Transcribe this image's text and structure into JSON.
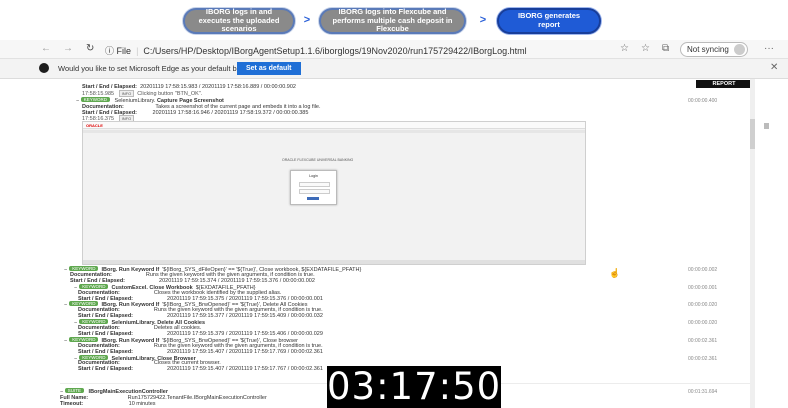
{
  "flow": {
    "steps": [
      "IBORG logs in and executes the uploaded scenarios",
      "IBORG logs into Flexcube and performs multiple cash deposit in Flexcube",
      "IBORG generates report"
    ],
    "arrow_glyph": ">"
  },
  "browser": {
    "back": "←",
    "forward": "→",
    "refresh": "↻",
    "info_icon": "ⓘ",
    "file_label": "File",
    "url": "C:/Users/HP/Desktop/IBorgAgentSetup1.1.6/iborglogs/19Nov2020/run175729422/IBorgLog.html",
    "star_icon": "☆",
    "favorites_icon": "☆",
    "collections_icon": "⧉",
    "sync_label": "Not syncing",
    "more_icon": "···"
  },
  "infobar": {
    "message": "Would you like to set Microsoft Edge as your default browser?",
    "button": "Set as default",
    "close": "✕"
  },
  "report": {
    "tag": "REPORT",
    "top_rows": [
      {
        "label": "Start / End / Elapsed:",
        "value": "20201119 17:58:15.983 / 20201119 17:58:16.889 / 00:00:00.902"
      },
      {
        "label": "17:58:15.985",
        "value": "Clicking button \"BTN_OK\"."
      }
    ],
    "capture": {
      "badge": "KEYWORD",
      "lib": "SeleniumLibrary.",
      "name": "Capture Page Screenshot",
      "doc_label": "Documentation:",
      "doc": "Takes a screenshot of the current page and embeds it into a log file.",
      "sel_label": "Start / End / Elapsed:",
      "sel": "20201119 17:58:16.946 / 20201119 17:58:19.372 / 00:00:00.385",
      "ts": "17:58:16.375",
      "detail": "INFO",
      "time": "00:00:00.400"
    },
    "screenshot": {
      "brand": "ORACLE",
      "app_title": "ORACLE FLEXCUBE UNIVERSAL BANKING",
      "login_title": "Login"
    },
    "entries": [
      {
        "prefix": "−",
        "badge": "KEYWORD",
        "kw": "IBorg. Run Keyword If",
        "args": "'${IBorg_SYS_dFileOpen}' == '${True}', Close workbook, ${EXDATAFILE_PFATH}",
        "time": "00:00:00.002"
      },
      {
        "prefix": "",
        "badge": "",
        "kw": "Documentation:",
        "args": "Runs the given keyword with the given arguments, if condition is true.",
        "time": ""
      },
      {
        "prefix": "",
        "badge": "",
        "kw": "Start / End / Elapsed:",
        "args": "20201119 17:59:15.374 / 20201119 17:59:15.376 / 00:00:00.002",
        "time": ""
      },
      {
        "prefix": "−",
        "badge": "KEYWORD",
        "kw": "CustomExcel. Close Workbook",
        "args": "${EXDATAFILE_PFATH}",
        "time": "00:00:00.001"
      },
      {
        "prefix": "",
        "badge": "",
        "kw": "Documentation:",
        "args": "Closes the workbook identified by the supplied alias.",
        "time": ""
      },
      {
        "prefix": "",
        "badge": "",
        "kw": "Start / End / Elapsed:",
        "args": "20201119 17:59:15.375 / 20201119 17:59:15.376 / 00:00:00.001",
        "time": ""
      },
      {
        "prefix": "−",
        "badge": "KEYWORD",
        "kw": "IBorg. Run Keyword If",
        "args": "'${IBorg_SYS_BrwOpened}' == '${True}', Delete All Cookies",
        "time": "00:00:00.020"
      },
      {
        "prefix": "",
        "badge": "",
        "kw": "Documentation:",
        "args": "Runs the given keyword with the given arguments, if condition is true.",
        "time": ""
      },
      {
        "prefix": "",
        "badge": "",
        "kw": "Start / End / Elapsed:",
        "args": "20201119 17:59:15.377 / 20201119 17:59:15.409 / 00:00:00.032",
        "time": ""
      },
      {
        "prefix": "−",
        "badge": "KEYWORD",
        "kw": "SeleniumLibrary. Delete All Cookies",
        "args": "",
        "time": "00:00:00.020"
      },
      {
        "prefix": "",
        "badge": "",
        "kw": "Documentation:",
        "args": "Deletes all cookies.",
        "time": ""
      },
      {
        "prefix": "",
        "badge": "",
        "kw": "Start / End / Elapsed:",
        "args": "20201119 17:59:15.379 / 20201119 17:59:15.406 / 00:00:00.029",
        "time": ""
      },
      {
        "prefix": "−",
        "badge": "KEYWORD",
        "kw": "IBorg. Run Keyword If",
        "args": "'${IBorg_SYS_BrwOpened}' == '${True}', Close browser",
        "time": "00:00:02.361"
      },
      {
        "prefix": "",
        "badge": "",
        "kw": "Documentation:",
        "args": "Runs the given keyword with the given arguments, if condition is true.",
        "time": ""
      },
      {
        "prefix": "",
        "badge": "",
        "kw": "Start / End / Elapsed:",
        "args": "20201119 17:59:15.407 / 20201119 17:59:17.769 / 00:00:02.361",
        "time": ""
      },
      {
        "prefix": "−",
        "badge": "KEYWORD",
        "kw": "SeleniumLibrary. Close Browser",
        "args": "",
        "time": "00:00:02.361"
      },
      {
        "prefix": "",
        "badge": "",
        "kw": "Documentation:",
        "args": "Closes the current browser.",
        "time": ""
      },
      {
        "prefix": "",
        "badge": "",
        "kw": "Start / End / Elapsed:",
        "args": "20201119 17:59:15.407 / 20201119 17:59:17.767 / 00:00:02.361",
        "time": ""
      }
    ],
    "suite": {
      "badge": "SUITE",
      "name": "IBorgMainExecutionController",
      "full_label": "Full Name:",
      "full": "Run175729422.TenantFile.IBorgMainExecutionController",
      "timeout_label": "Timeout:",
      "timeout": "10 minutes",
      "time": "00:01:31.694"
    }
  },
  "clock": "03:17:50",
  "cursor_icon": "☝"
}
